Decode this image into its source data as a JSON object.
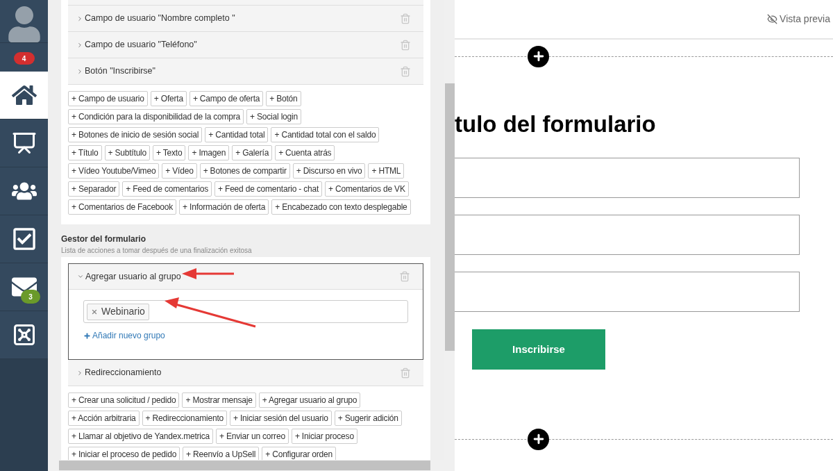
{
  "sidebar": {
    "notification_count": "4",
    "nav": [
      {
        "selected": true
      },
      {
        "selected": false
      },
      {
        "selected": false
      },
      {
        "selected": false
      },
      {
        "selected": false,
        "badge": "3"
      },
      {
        "selected": false
      }
    ]
  },
  "editor": {
    "fields": [
      {
        "label": "Campo de usuario \"Nombre completo \"",
        "expanded": false
      },
      {
        "label": "Campo de usuario \"Teléfono\"",
        "expanded": false
      },
      {
        "label": "Botón \"Inscribirse\"",
        "expanded": false
      }
    ],
    "element_buttons": [
      [
        "+ Campo de usuario",
        "+ Oferta",
        "+ Campo de oferta",
        "+ Botón"
      ],
      [
        "+ Condición para la disponibilidad de la compra",
        "+ Social login"
      ],
      [
        "+ Botones de inicio de sesión social",
        "+ Cantidad total",
        "+ Cantidad total con el saldo"
      ],
      [
        "+ Título",
        "+ Subtítulo",
        "+ Texto",
        "+ Imagen",
        "+ Galería",
        "+ Cuenta atrás"
      ],
      [
        "+ Vídeo Youtube/Vimeo",
        "+ Vídeo",
        "+ Botones de compartir",
        "+ Discurso en vivo",
        "+ HTML"
      ],
      [
        "+ Separador",
        "+ Feed de comentarios",
        "+ Feed de comentario - chat",
        "+ Comentarios de VK"
      ],
      [
        "+ Comentarios de Facebook",
        "+ Información de oferta",
        "+ Encabezado con texto desplegable"
      ]
    ],
    "form_handler": {
      "title": "Gestor del formulario",
      "subtitle": "Lista de acciones a tomar después de una finalización exitosa",
      "actions": [
        {
          "label": "Agregar usuario al grupo",
          "expanded": true,
          "groups": [
            "Webinario"
          ],
          "add_group": "Añadir nuevo grupo"
        },
        {
          "label": "Redireccionamiento",
          "expanded": false
        }
      ],
      "action_buttons": [
        [
          "+ Crear una solicitud / pedido",
          "+ Mostrar mensaje",
          "+ Agregar usuario al grupo"
        ],
        [
          "+ Acción arbitraria",
          "+ Redireccionamiento",
          "+ Iniciar sesión del usuario",
          "+ Sugerir adición"
        ],
        [
          "+ Llamar al objetivo de Yandex.metrica",
          "+ Enviar un correo",
          "+ Iniciar proceso"
        ],
        [
          "+ Iniciar el proceso de pedido",
          "+ Reenvío a UpSell",
          "+ Configurar orden"
        ]
      ]
    }
  },
  "preview": {
    "preview_link": "Vista previa",
    "form_title": "tulo del formulario",
    "submit": "Inscribirse"
  }
}
